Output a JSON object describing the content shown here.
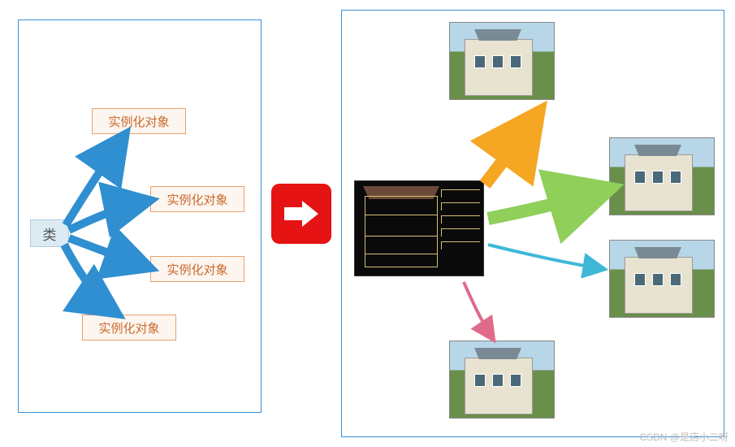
{
  "left": {
    "class_label": "类",
    "instances": [
      "实例化对象",
      "实例化对象",
      "实例化对象",
      "实例化对象"
    ]
  },
  "right": {
    "source": "blueprint",
    "outputs": [
      "house-render",
      "house-render",
      "house-render",
      "house-render"
    ]
  },
  "colors": {
    "panel_border": "#3a8fd6",
    "red_block": "#e51313",
    "blue_arrow": "#2f8fd0",
    "orange_arrow": "#f5a623",
    "green_arrow": "#8fcf5a",
    "cyan_arrow": "#3fb8d8",
    "pink_arrow": "#e06a8a"
  },
  "watermark": "CSDN @是店小二呀"
}
